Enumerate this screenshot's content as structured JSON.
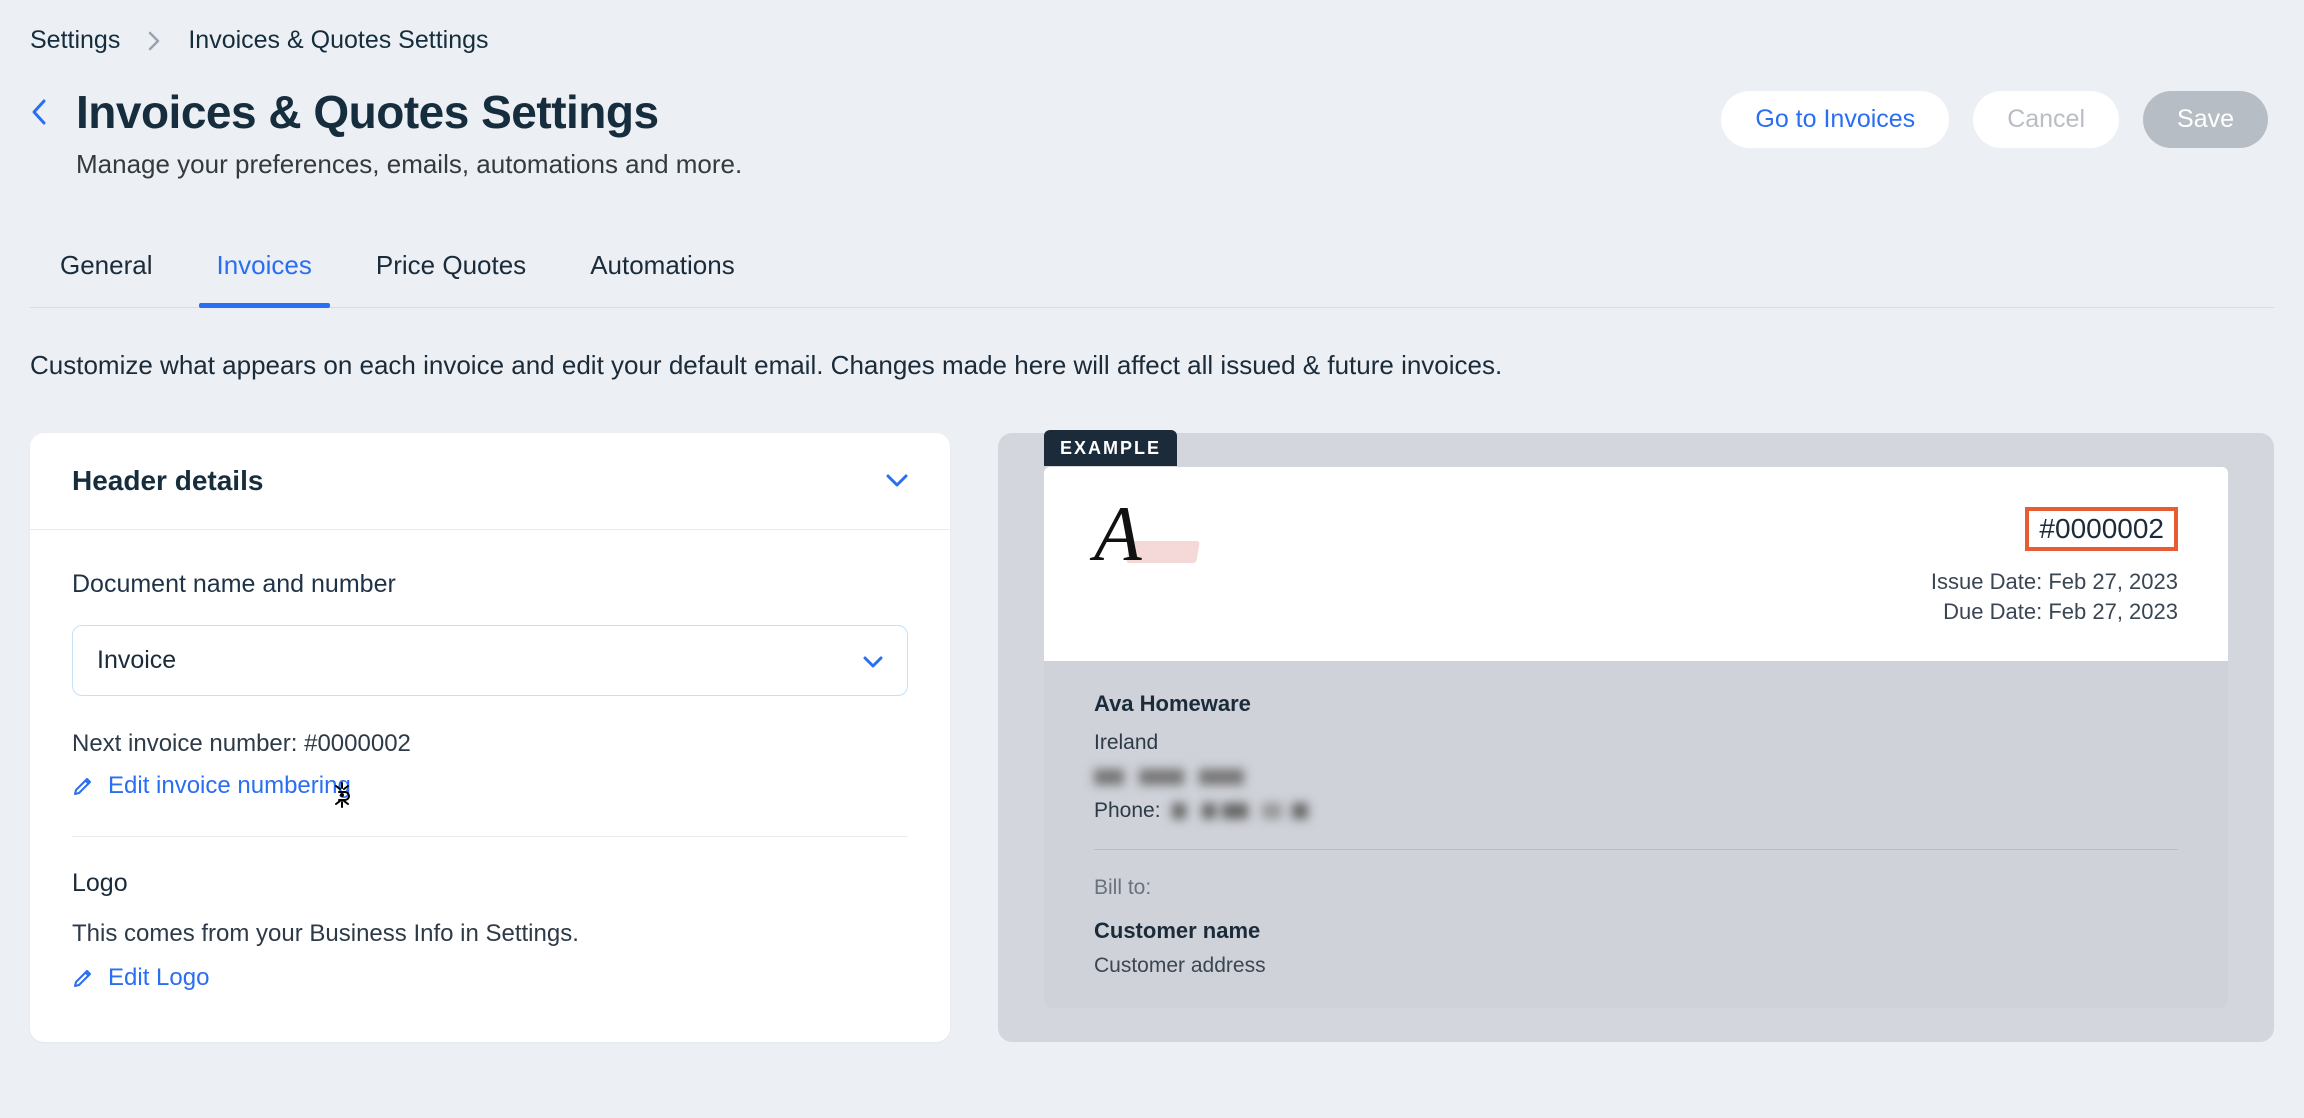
{
  "breadcrumb": {
    "root": "Settings",
    "current": "Invoices & Quotes Settings"
  },
  "header": {
    "title": "Invoices & Quotes Settings",
    "subtitle": "Manage your preferences, emails, automations and more.",
    "actions": {
      "goto": "Go to Invoices",
      "cancel": "Cancel",
      "save": "Save"
    }
  },
  "tabs": [
    "General",
    "Invoices",
    "Price Quotes",
    "Automations"
  ],
  "active_tab": 1,
  "intro": "Customize what appears on each invoice and edit your default email. Changes made here will affect all issued & future invoices.",
  "panel": {
    "title": "Header details",
    "doc_section_label": "Document name and number",
    "doc_type_value": "Invoice",
    "next_number_line": "Next invoice number: #0000002",
    "edit_numbering_link": "Edit invoice numbering",
    "logo_title": "Logo",
    "logo_desc": "This comes from your Business Info in Settings.",
    "edit_logo_link": "Edit Logo"
  },
  "preview": {
    "example_label": "EXAMPLE",
    "invoice_number": "#0000002",
    "issue_date_label": "Issue Date:",
    "issue_date": "Feb 27, 2023",
    "due_date_label": "Due Date:",
    "due_date": "Feb 27, 2023",
    "business_name": "Ava Homeware",
    "business_country": "Ireland",
    "phone_label": "Phone:",
    "bill_to_label": "Bill to:",
    "customer_name": "Customer name",
    "customer_address": "Customer address",
    "logo_glyph": "A"
  }
}
